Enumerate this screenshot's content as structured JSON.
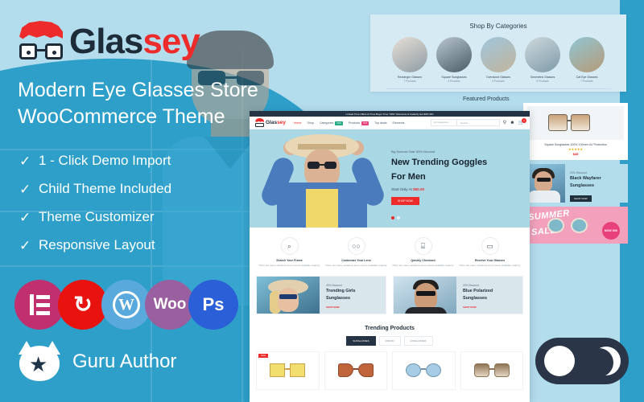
{
  "brand": {
    "logo_primary": "Glas",
    "logo_accent": "sey",
    "mark_icon": "glasses-hair-logo-icon",
    "accent_red": "#ee2b2b",
    "dark_navy": "#1e2b38",
    "panel_blue": "#2e9fc9",
    "light_blue": "#b3dced"
  },
  "headline": {
    "line1": "Modern Eye Glasses Store",
    "line2": "WooCommerce Theme"
  },
  "features": [
    {
      "tick": "✓",
      "label": "1 - Click Demo Import"
    },
    {
      "tick": "✓",
      "label": "Child Theme Included"
    },
    {
      "tick": "✓",
      "label": "Theme Customizer"
    },
    {
      "tick": "✓",
      "label": "Responsive Layout"
    }
  ],
  "tech_badges": [
    {
      "name": "elementor-badge",
      "label": "E",
      "color": "#c0306f"
    },
    {
      "name": "one-click-update-badge",
      "label": "↻",
      "color": "#e8120f"
    },
    {
      "name": "wordpress-badge",
      "label": "W",
      "color": "#5aa9dd"
    },
    {
      "name": "woocommerce-badge",
      "label": "Woo",
      "color": "#9a5f9e"
    },
    {
      "name": "photoshop-badge",
      "label": "Ps",
      "color": "#2a5fd8"
    }
  ],
  "author": {
    "label": "Guru Author",
    "icon": "cat-star-badge-icon"
  },
  "categories_panel": {
    "title": "Shop By Categories",
    "items": [
      {
        "name": "Rectangle Glasses",
        "count": "7 Products"
      },
      {
        "name": "Square Sunglasses",
        "count": "4 Products"
      },
      {
        "name": "Oversized Glasses",
        "count": "6 Products"
      },
      {
        "name": "Geometric Glasses",
        "count": "5 Products"
      },
      {
        "name": "Cat Eye Glasses",
        "count": "7 Products"
      }
    ]
  },
  "featured_label": "Featured Products",
  "right_column": {
    "product": {
      "name": "Square Sunglasses 100% 100mm UV Protection",
      "stars": "★★★★★",
      "price": "$45"
    },
    "banner": {
      "discount": "20% Discount",
      "title_line1": "Black Wayfarer",
      "title_line2": "Sunglasses",
      "button": "SHOP NOW"
    },
    "summer": {
      "line1": "SUMMER",
      "line2": "SALE",
      "badge": "NOW ON!"
    }
  },
  "mockup": {
    "announcement": "Limited Time Offers  At Time Buyer Time \"50%\" Discounts & Instantly Get $35 OFF",
    "nav": {
      "menu": [
        {
          "label": "Home",
          "active": true,
          "tag": ""
        },
        {
          "label": "Shop",
          "active": false,
          "tag": ""
        },
        {
          "label": "Categories",
          "active": false,
          "tag": "NEW",
          "tag_color": "green"
        },
        {
          "label": "Products",
          "active": false,
          "tag": "HOT",
          "tag_color": "pink"
        },
        {
          "label": "Top deals",
          "active": false,
          "tag": ""
        },
        {
          "label": "Elements",
          "active": false,
          "tag": ""
        }
      ],
      "search_category": "All Categories",
      "search_placeholder": "Search...",
      "cart_count": "0",
      "icons": [
        "search-icon",
        "user-icon",
        "cart-icon"
      ]
    },
    "hero": {
      "eyebrow": "Big Summer Sale 50% Discount",
      "title_line1": "New Trending Goggles",
      "title_line2": "For Men",
      "price_prefix": "Start Only At ",
      "price": "$50.00",
      "cta": "SHOP NOW"
    },
    "services": [
      {
        "icon": "search-icon",
        "glyph": "⌕",
        "title": "Search Your Frame",
        "desc": "There are many variations lorem ipsum available majority."
      },
      {
        "icon": "eyeglasses-icon",
        "glyph": "○○",
        "title": "Customize Your Lens",
        "desc": "There are many variations lorem ipsum available majority."
      },
      {
        "icon": "basket-icon",
        "glyph": "⌸",
        "title": "Quickly Checkout",
        "desc": "There are many variations lorem ipsum available majority."
      },
      {
        "icon": "truck-icon",
        "glyph": "▭",
        "title": "Receive Your Glasses",
        "desc": "There are many variations lorem ipsum available majority."
      }
    ],
    "promos": [
      {
        "discount": "20% Discount",
        "title_line1": "Trending Girls",
        "title_line2": "Sunglasses",
        "button": "SHOP NOW"
      },
      {
        "discount": "20% Discount",
        "title_line1": "Blue Polarized",
        "title_line2": "Sunglasses",
        "button": "SHOP NOW"
      }
    ],
    "trending": {
      "title": "Trending Products",
      "tabs": [
        {
          "label": "SUNGLASSES",
          "active": true
        },
        {
          "label": "ROUND",
          "active": false
        },
        {
          "label": "EYEGLASSES",
          "active": false
        }
      ],
      "products": [
        {
          "badge": "SALE",
          "lens_color": "#f2de6e",
          "frame_color": "#caa34a"
        },
        {
          "badge": "",
          "lens_color": "#c0643c",
          "frame_color": "#8c4a2b"
        },
        {
          "badge": "",
          "lens_color": "#a7cde6",
          "frame_color": "#6f93ad"
        },
        {
          "badge": "",
          "lens_color": "#c6a887",
          "frame_color": "#8d7454"
        }
      ]
    }
  },
  "dark_mode_toggle": {
    "sun_icon": "sun-circle-icon",
    "moon_icon": "crescent-moon-icon",
    "state": "light"
  }
}
